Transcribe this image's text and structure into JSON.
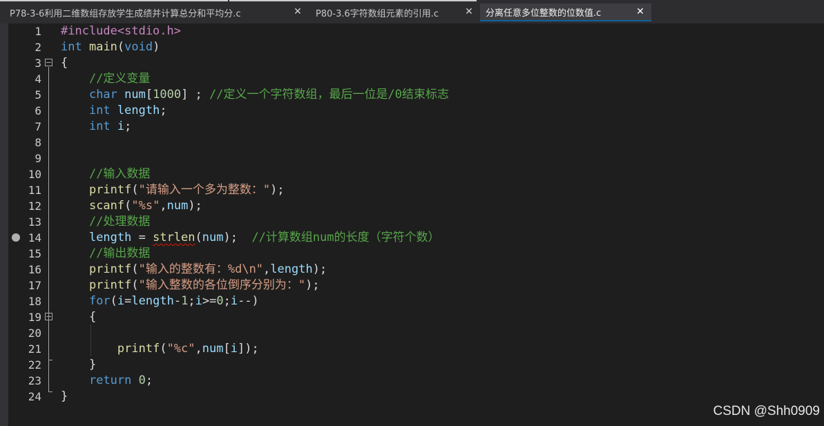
{
  "tabs": [
    {
      "label": "P78-3-6利用二维数组存放学生成绩并计算总分和平均分.c",
      "active": false
    },
    {
      "label": "P80-3.6字符数组元素的引用.c",
      "active": false
    },
    {
      "label": "分离任意多位整数的位数值.c",
      "active": true
    }
  ],
  "tab_close_glyph": "✕",
  "line_numbers": [
    "1",
    "2",
    "3",
    "4",
    "5",
    "6",
    "7",
    "8",
    "9",
    "10",
    "11",
    "12",
    "13",
    "14",
    "15",
    "16",
    "17",
    "18",
    "19",
    "20",
    "21",
    "22",
    "23",
    "24"
  ],
  "code": [
    [
      [
        "pp",
        "#include<stdio.h>"
      ]
    ],
    [
      [
        "kw",
        "int"
      ],
      [
        "p",
        " "
      ],
      [
        "fn",
        "main"
      ],
      [
        "p",
        "("
      ],
      [
        "kw",
        "void"
      ],
      [
        "p",
        ")"
      ]
    ],
    [
      [
        "p",
        "{"
      ]
    ],
    [
      [
        "p",
        "    "
      ],
      [
        "cm",
        "//定义变量"
      ]
    ],
    [
      [
        "p",
        "    "
      ],
      [
        "kw",
        "char"
      ],
      [
        "p",
        " "
      ],
      [
        "var",
        "num"
      ],
      [
        "p",
        "["
      ],
      [
        "num",
        "1000"
      ],
      [
        "p",
        "] ; "
      ],
      [
        "cm",
        "//定义一个字符数组，最后一位是/0结束标志"
      ]
    ],
    [
      [
        "p",
        "    "
      ],
      [
        "kw",
        "int"
      ],
      [
        "p",
        " "
      ],
      [
        "var",
        "length"
      ],
      [
        "p",
        ";"
      ]
    ],
    [
      [
        "p",
        "    "
      ],
      [
        "kw",
        "int"
      ],
      [
        "p",
        " "
      ],
      [
        "var",
        "i"
      ],
      [
        "p",
        ";"
      ]
    ],
    [],
    [],
    [
      [
        "p",
        "    "
      ],
      [
        "cm",
        "//输入数据"
      ]
    ],
    [
      [
        "p",
        "    "
      ],
      [
        "fn",
        "printf"
      ],
      [
        "p",
        "("
      ],
      [
        "str",
        "\"请输入一个多为整数：\""
      ],
      [
        "p",
        ");"
      ]
    ],
    [
      [
        "p",
        "    "
      ],
      [
        "fn",
        "scanf"
      ],
      [
        "p",
        "("
      ],
      [
        "str",
        "\"%s\""
      ],
      [
        "p",
        ","
      ],
      [
        "var",
        "num"
      ],
      [
        "p",
        ");"
      ]
    ],
    [
      [
        "p",
        "    "
      ],
      [
        "cm",
        "//处理数据"
      ]
    ],
    [
      [
        "p",
        "    "
      ],
      [
        "var",
        "length"
      ],
      [
        "p",
        " = "
      ],
      [
        "fnsq",
        "strlen"
      ],
      [
        "p",
        "("
      ],
      [
        "var",
        "num"
      ],
      [
        "p",
        ");  "
      ],
      [
        "cm",
        "//计算数组num的长度（字符个数）"
      ]
    ],
    [
      [
        "p",
        "    "
      ],
      [
        "cm",
        "//输出数据"
      ]
    ],
    [
      [
        "p",
        "    "
      ],
      [
        "fn",
        "printf"
      ],
      [
        "p",
        "("
      ],
      [
        "str",
        "\"输入的整数有：%d\\n\""
      ],
      [
        "p",
        ","
      ],
      [
        "var",
        "length"
      ],
      [
        "p",
        ");"
      ]
    ],
    [
      [
        "p",
        "    "
      ],
      [
        "fn",
        "printf"
      ],
      [
        "p",
        "("
      ],
      [
        "str",
        "\"输入整数的各位倒序分别为：\""
      ],
      [
        "p",
        ");"
      ]
    ],
    [
      [
        "p",
        "    "
      ],
      [
        "kw",
        "for"
      ],
      [
        "p",
        "("
      ],
      [
        "var",
        "i"
      ],
      [
        "p",
        "="
      ],
      [
        "var",
        "length"
      ],
      [
        "p",
        "-"
      ],
      [
        "num",
        "1"
      ],
      [
        "p",
        ";"
      ],
      [
        "var",
        "i"
      ],
      [
        "p",
        ">="
      ],
      [
        "num",
        "0"
      ],
      [
        "p",
        ";"
      ],
      [
        "var",
        "i"
      ],
      [
        "p",
        "--)"
      ]
    ],
    [
      [
        "p",
        "    {"
      ]
    ],
    [],
    [
      [
        "p",
        "        "
      ],
      [
        "fn",
        "printf"
      ],
      [
        "p",
        "("
      ],
      [
        "str",
        "\"%c\""
      ],
      [
        "p",
        ","
      ],
      [
        "var",
        "num"
      ],
      [
        "p",
        "["
      ],
      [
        "var",
        "i"
      ],
      [
        "p",
        "]);"
      ]
    ],
    [
      [
        "p",
        "    }"
      ]
    ],
    [
      [
        "p",
        "    "
      ],
      [
        "kw",
        "return"
      ],
      [
        "p",
        " "
      ],
      [
        "num",
        "0"
      ],
      [
        "p",
        ";"
      ]
    ],
    [
      [
        "p",
        "}"
      ]
    ]
  ],
  "watermark": "CSDN @Shh0909",
  "colors": {
    "background": "#1e1e1e",
    "tabbar": "#2d2d30",
    "active_tab": "#3e3e42",
    "keyword": "#569cd6",
    "function": "#dcdcaa",
    "string": "#d69d85",
    "comment": "#57a64a",
    "number": "#b5cea8",
    "preprocessor": "#c586c0",
    "variable": "#9cdcfe"
  }
}
